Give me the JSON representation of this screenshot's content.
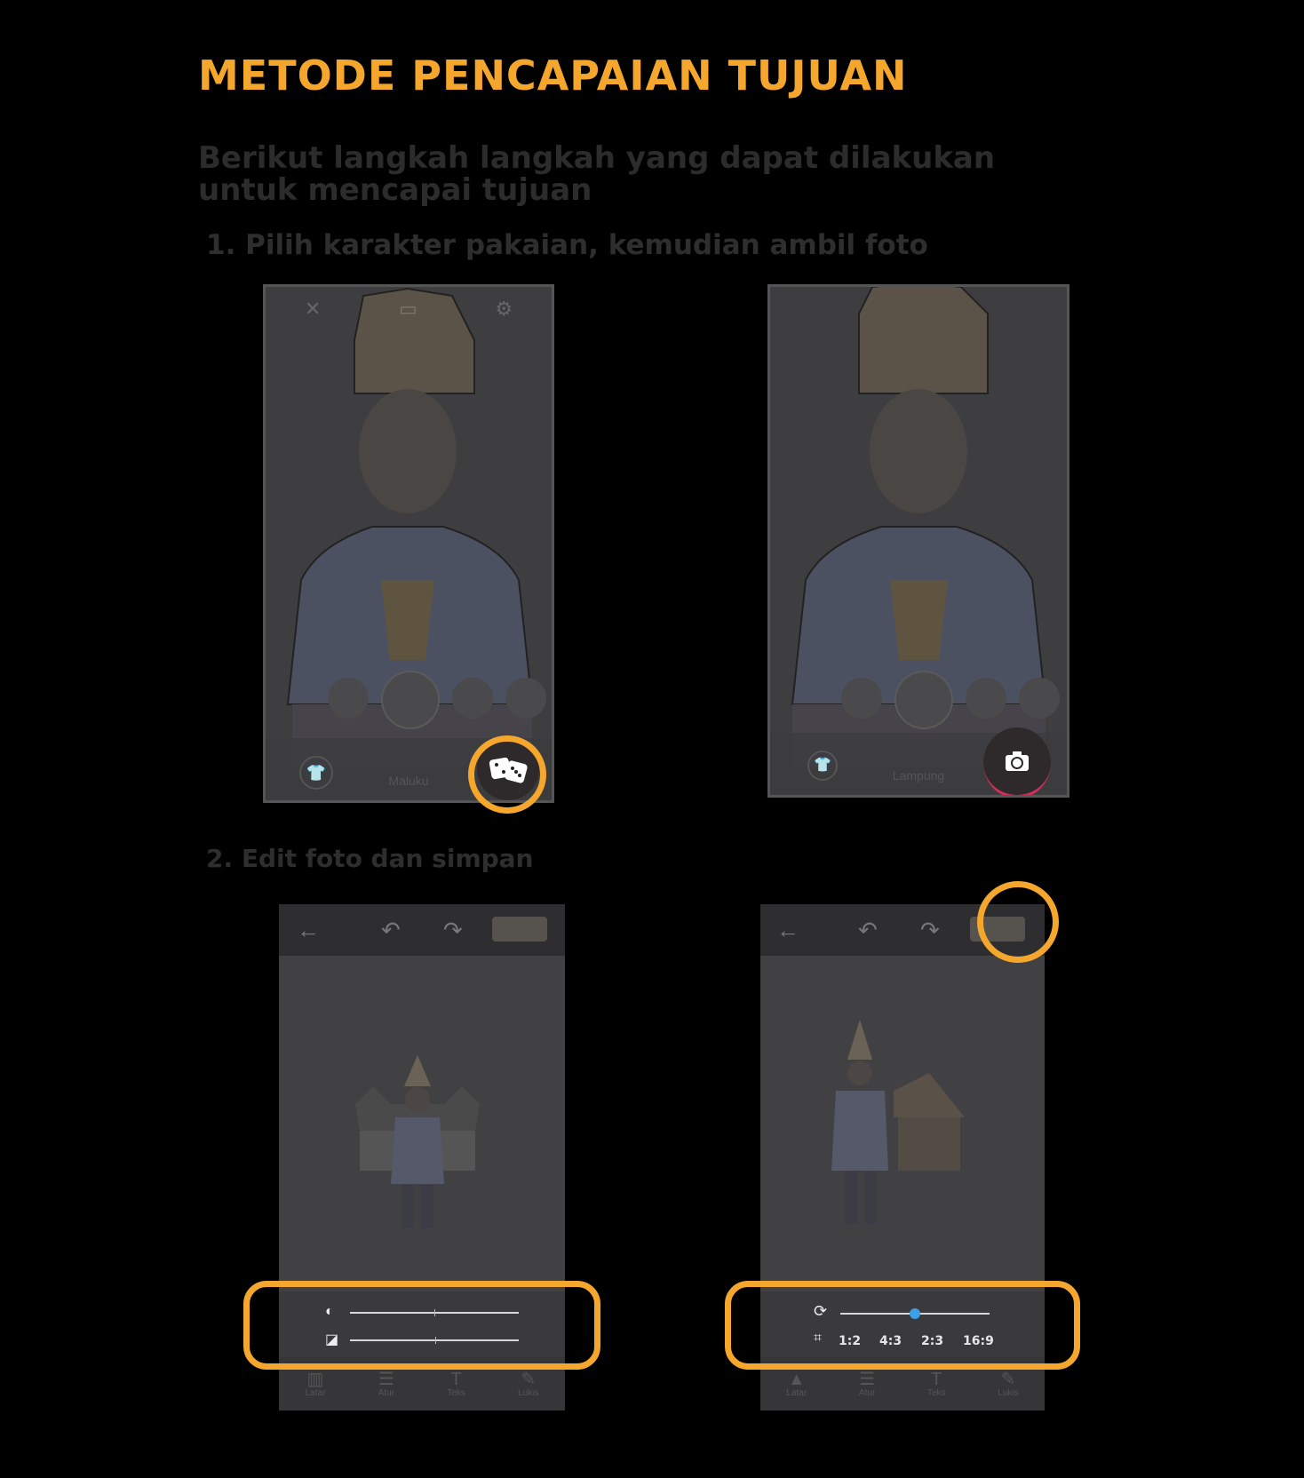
{
  "title": "METODE PENCAPAIAN TUJUAN",
  "intro": "Berikut langkah langkah yang dapat dilakukan untuk mencapai tujuan",
  "step1": "1. Pilih karakter pakaian, kemudian ambil foto",
  "step2": "2. Edit foto dan simpan",
  "phone_left": {
    "region_label": "Maluku",
    "action_icon": "dice-icon"
  },
  "phone_right": {
    "region_label": "Lampung",
    "action_icon": "camera-icon"
  },
  "editor_left": {
    "brightness_icon": "brightness-icon",
    "contrast_icon": "contrast-icon",
    "tabs": [
      "Latar",
      "Atur",
      "Teks",
      "Lukis"
    ]
  },
  "editor_right": {
    "rotate_icon": "rotate-icon",
    "crop_icon": "crop-icon",
    "ratios": [
      "1:2",
      "4:3",
      "2:3",
      "16:9"
    ],
    "rotate_level": 0.5,
    "tabs": [
      "Latar",
      "Atur",
      "Teks",
      "Lukis"
    ]
  },
  "colors": {
    "accent": "#f4a72c",
    "slider_knob": "#3aa0e8"
  }
}
